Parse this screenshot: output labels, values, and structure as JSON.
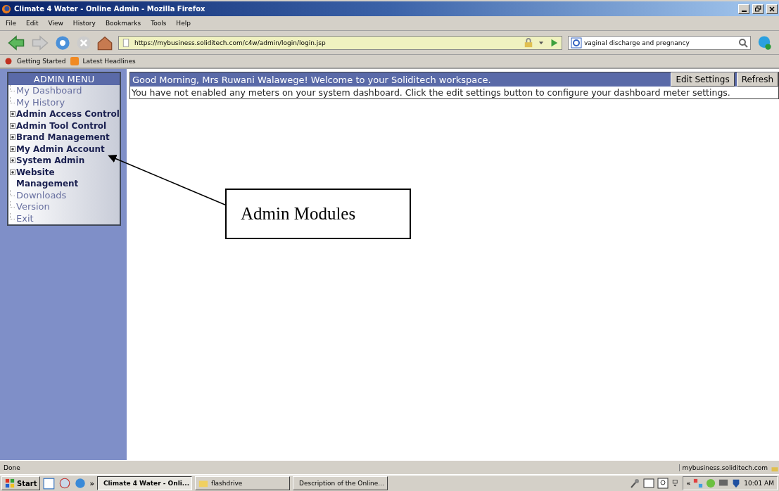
{
  "window": {
    "title": "Climate 4 Water - Online Admin - Mozilla Firefox"
  },
  "menu_bar": [
    "File",
    "Edit",
    "View",
    "History",
    "Bookmarks",
    "Tools",
    "Help"
  ],
  "address_bar": {
    "url": "https://mybusiness.soliditech.com/c4w/admin/login/login.jsp"
  },
  "search": {
    "value": "vaginal discharge and pregnancy"
  },
  "bookmarks": [
    "Getting Started",
    "Latest Headlines"
  ],
  "sidebar": {
    "title": "ADMIN MENU",
    "items": [
      {
        "label": "My Dashboard",
        "kind": "link"
      },
      {
        "label": "My History",
        "kind": "link"
      },
      {
        "label": "Admin Access Control",
        "kind": "group",
        "expanded": false
      },
      {
        "label": "Admin Tool Control",
        "kind": "group",
        "expanded": false
      },
      {
        "label": "Brand Management",
        "kind": "group",
        "expanded": false
      },
      {
        "label": "My Admin Account",
        "kind": "group",
        "expanded": false
      },
      {
        "label": "System Admin",
        "kind": "group",
        "expanded": false
      },
      {
        "label": "Website Management",
        "kind": "group",
        "expanded": false
      },
      {
        "label": "Downloads",
        "kind": "link"
      },
      {
        "label": "Version",
        "kind": "link"
      },
      {
        "label": "Exit",
        "kind": "link"
      }
    ]
  },
  "panel": {
    "greeting": "Good Morning, Mrs Ruwani Walawege! Welcome to your Soliditech workspace.",
    "buttons": [
      "Edit Settings",
      "Refresh"
    ],
    "message": "You have not enabled any meters on your system dashboard. Click the edit settings button to configure your dashboard meter settings."
  },
  "callout": {
    "text": "Admin Modules"
  },
  "status_bar": {
    "text": "Done",
    "host": "mybusiness.soliditech.com"
  },
  "taskbar": {
    "start": "Start",
    "overflow": "»",
    "tasks": [
      {
        "label": "Climate 4 Water - Onli...",
        "selected": true
      },
      {
        "label": "flashdrive",
        "selected": false
      },
      {
        "label": "Description of the Online...",
        "selected": false
      }
    ],
    "tray_overflow": "«",
    "clock": "10:01 AM"
  }
}
